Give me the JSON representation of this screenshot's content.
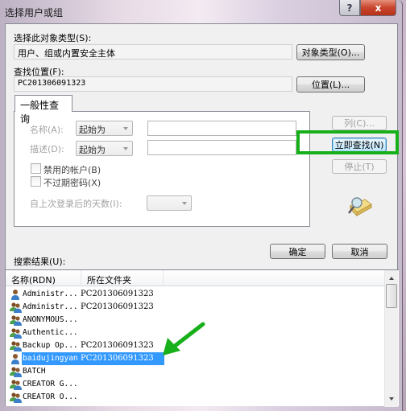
{
  "window": {
    "title": "选择用户或组",
    "help_label": "?",
    "close_label": "x"
  },
  "object_type": {
    "label": "选择此对象类型(S):",
    "value": "用户、组或内置安全主体",
    "button": "对象类型(O)..."
  },
  "location": {
    "label": "查找位置(F):",
    "value": "PC201306091323",
    "button": "位置(L)..."
  },
  "query": {
    "tab_label": "一般性查询",
    "name_label": "名称(A):",
    "name_mode": "起始为",
    "name_value": "",
    "desc_label": "描述(D):",
    "desc_mode": "起始为",
    "desc_value": "",
    "disabled_accounts": {
      "label": "禁用的帐户(B)",
      "checked": false
    },
    "non_expiring_pw": {
      "label": "不过期密码(X)",
      "checked": false
    },
    "days_label": "自上次登录后的天数(I):",
    "days_value": ""
  },
  "side_buttons": {
    "columns": "列(C)...",
    "find_now": "立即查找(N)",
    "stop": "停止(T)"
  },
  "dialog_buttons": {
    "ok": "确定",
    "cancel": "取消"
  },
  "results": {
    "label": "搜索结果(U):",
    "columns": [
      "名称(RDN)",
      "所在文件夹"
    ],
    "rows": [
      {
        "name": "Administr...",
        "folder": "PC201306091323",
        "icon": "user-icon",
        "selected": false
      },
      {
        "name": "Administr...",
        "folder": "PC201306091323",
        "icon": "group-icon",
        "selected": false
      },
      {
        "name": "ANONYMOUS...",
        "folder": "",
        "icon": "group-icon",
        "selected": false
      },
      {
        "name": "Authentic...",
        "folder": "",
        "icon": "group-icon",
        "selected": false
      },
      {
        "name": "Backup Op...",
        "folder": "PC201306091323",
        "icon": "group-icon",
        "selected": false
      },
      {
        "name": "baidujingyan",
        "folder": "PC201306091323",
        "icon": "user-icon",
        "selected": true
      },
      {
        "name": "BATCH",
        "folder": "",
        "icon": "group-icon",
        "selected": false
      },
      {
        "name": "CREATOR G...",
        "folder": "",
        "icon": "group-icon",
        "selected": false
      },
      {
        "name": "CREATOR O...",
        "folder": "",
        "icon": "group-icon",
        "selected": false
      }
    ]
  },
  "annotations": {
    "highlight_color": "#17b01a",
    "arrow_color": "#17b01a"
  }
}
